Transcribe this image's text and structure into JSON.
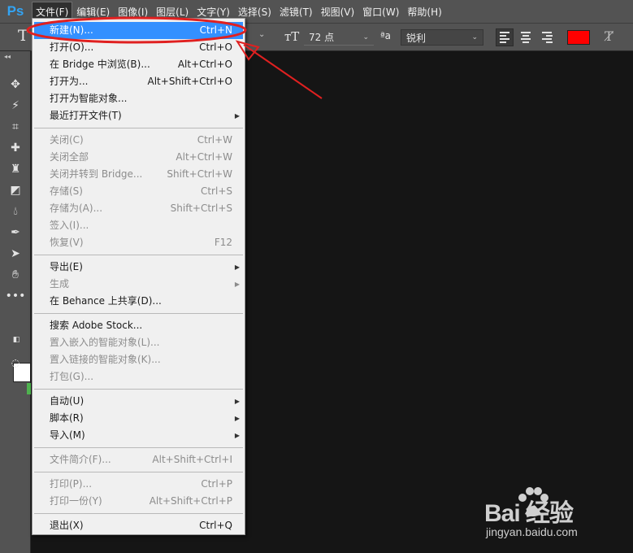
{
  "app": {
    "logo": "Ps"
  },
  "menubar": {
    "items": [
      "文件(F)",
      "编辑(E)",
      "图像(I)",
      "图层(L)",
      "文字(Y)",
      "选择(S)",
      "滤镜(T)",
      "视图(V)",
      "窗口(W)",
      "帮助(H)"
    ],
    "active_index": 0
  },
  "options_bar": {
    "font_size": "72 点",
    "antialias_label": "a",
    "antialias_value": "锐利",
    "text_color": "#ff0000",
    "tool_icon": "horizontal-type-icon"
  },
  "file_menu": {
    "groups": [
      [
        {
          "label": "新建(N)...",
          "shortcut": "Ctrl+N",
          "enabled": true,
          "highlighted": true
        },
        {
          "label": "打开(O)...",
          "shortcut": "Ctrl+O",
          "enabled": true
        },
        {
          "label": "在 Bridge 中浏览(B)...",
          "shortcut": "Alt+Ctrl+O",
          "enabled": true
        },
        {
          "label": "打开为...",
          "shortcut": "Alt+Shift+Ctrl+O",
          "enabled": true
        },
        {
          "label": "打开为智能对象...",
          "shortcut": "",
          "enabled": true
        },
        {
          "label": "最近打开文件(T)",
          "shortcut": "",
          "enabled": true,
          "submenu": true
        }
      ],
      [
        {
          "label": "关闭(C)",
          "shortcut": "Ctrl+W",
          "enabled": false
        },
        {
          "label": "关闭全部",
          "shortcut": "Alt+Ctrl+W",
          "enabled": false
        },
        {
          "label": "关闭并转到 Bridge...",
          "shortcut": "Shift+Ctrl+W",
          "enabled": false
        },
        {
          "label": "存储(S)",
          "shortcut": "Ctrl+S",
          "enabled": false
        },
        {
          "label": "存储为(A)...",
          "shortcut": "Shift+Ctrl+S",
          "enabled": false
        },
        {
          "label": "签入(I)...",
          "shortcut": "",
          "enabled": false
        },
        {
          "label": "恢复(V)",
          "shortcut": "F12",
          "enabled": false
        }
      ],
      [
        {
          "label": "导出(E)",
          "shortcut": "",
          "enabled": true,
          "submenu": true
        },
        {
          "label": "生成",
          "shortcut": "",
          "enabled": false,
          "submenu": true
        },
        {
          "label": "在 Behance 上共享(D)...",
          "shortcut": "",
          "enabled": true
        }
      ],
      [
        {
          "label": "搜索 Adobe Stock...",
          "shortcut": "",
          "enabled": true
        },
        {
          "label": "置入嵌入的智能对象(L)...",
          "shortcut": "",
          "enabled": false
        },
        {
          "label": "置入链接的智能对象(K)...",
          "shortcut": "",
          "enabled": false
        },
        {
          "label": "打包(G)...",
          "shortcut": "",
          "enabled": false
        }
      ],
      [
        {
          "label": "自动(U)",
          "shortcut": "",
          "enabled": true,
          "submenu": true
        },
        {
          "label": "脚本(R)",
          "shortcut": "",
          "enabled": true,
          "submenu": true
        },
        {
          "label": "导入(M)",
          "shortcut": "",
          "enabled": true,
          "submenu": true
        }
      ],
      [
        {
          "label": "文件简介(F)...",
          "shortcut": "Alt+Shift+Ctrl+I",
          "enabled": false
        }
      ],
      [
        {
          "label": "打印(P)...",
          "shortcut": "Ctrl+P",
          "enabled": false
        },
        {
          "label": "打印一份(Y)",
          "shortcut": "Alt+Shift+Ctrl+P",
          "enabled": false
        }
      ],
      [
        {
          "label": "退出(X)",
          "shortcut": "Ctrl+Q",
          "enabled": true
        }
      ]
    ]
  },
  "watermark": {
    "brand": "Bai 经验",
    "url": "jingyan.baidu.com"
  },
  "colors": {
    "highlight": "#3390ff",
    "annotation": "#e02020",
    "foreground_swatch": "#ffffff"
  }
}
